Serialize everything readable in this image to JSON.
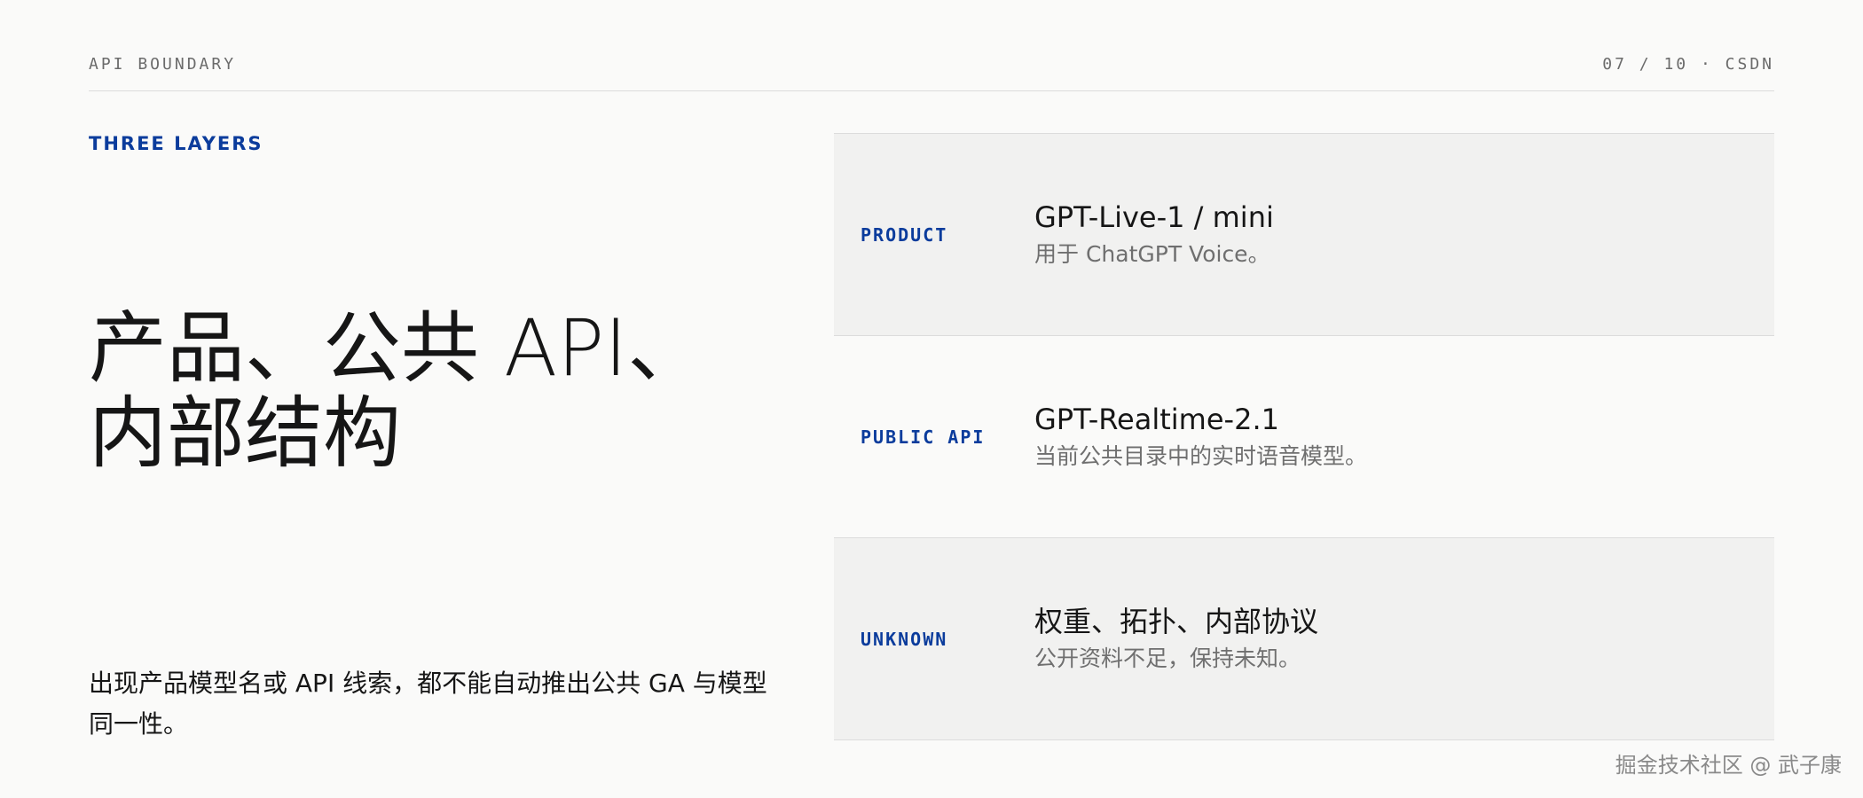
{
  "header": {
    "section": "API BOUNDARY",
    "page_indicator": "07 / 10 · CSDN"
  },
  "eyebrow": "THREE LAYERS",
  "headline": {
    "line1": "产品、公共 API、",
    "line2": "内部结构"
  },
  "note": "出现产品模型名或 API 线索，都不能自动推出公共 GA 与模型同一性。",
  "layers": [
    {
      "tag": "PRODUCT",
      "title": "GPT-Live-1 / mini",
      "desc": "用于 ChatGPT Voice。"
    },
    {
      "tag": "PUBLIC API",
      "title": "GPT-Realtime-2.1",
      "desc": "当前公共目录中的实时语音模型。"
    },
    {
      "tag": "UNKNOWN",
      "title": "权重、拓扑、内部协议",
      "desc": "公开资料不足，保持未知。"
    }
  ],
  "watermark": "掘金技术社区 @ 武子康",
  "colors": {
    "accent": "#0b3c9c",
    "background": "#fafaf9",
    "shaded_row": "#f1f1f0",
    "divider": "#dcdcdc"
  }
}
